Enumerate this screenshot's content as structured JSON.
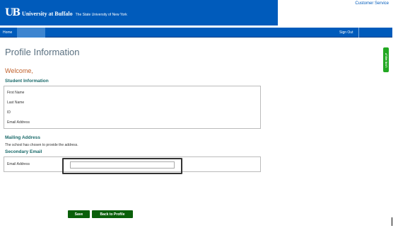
{
  "header": {
    "logo_mark": "UB",
    "university_name": "University at Buffalo",
    "subtitle": "The State University of New York",
    "customer_service": "Customer Service"
  },
  "nav": {
    "home": "Home",
    "blank_tab": "",
    "sign_out": "Sign Out"
  },
  "live_help": "LIVE HELP",
  "page": {
    "title": "Profile Information",
    "welcome": "Welcome,"
  },
  "student_info": {
    "heading": "Student Information",
    "fields": [
      "First Name",
      "Last Name",
      "ID",
      "Email Address"
    ]
  },
  "mailing_address": {
    "heading": "Mailing Address",
    "note": "The school has chosen to provide the address."
  },
  "secondary_email": {
    "heading": "Secondary Email",
    "label": "Email Address",
    "value": "",
    "placeholder": ""
  },
  "buttons": {
    "save": "Save",
    "back": "Back to Profile"
  },
  "colors": {
    "brand_blue": "#005bbb",
    "heading_teal": "#1a6a6a",
    "welcome_orange": "#c0602b",
    "button_green": "#0a5f0a",
    "live_help_green": "#22a822"
  }
}
